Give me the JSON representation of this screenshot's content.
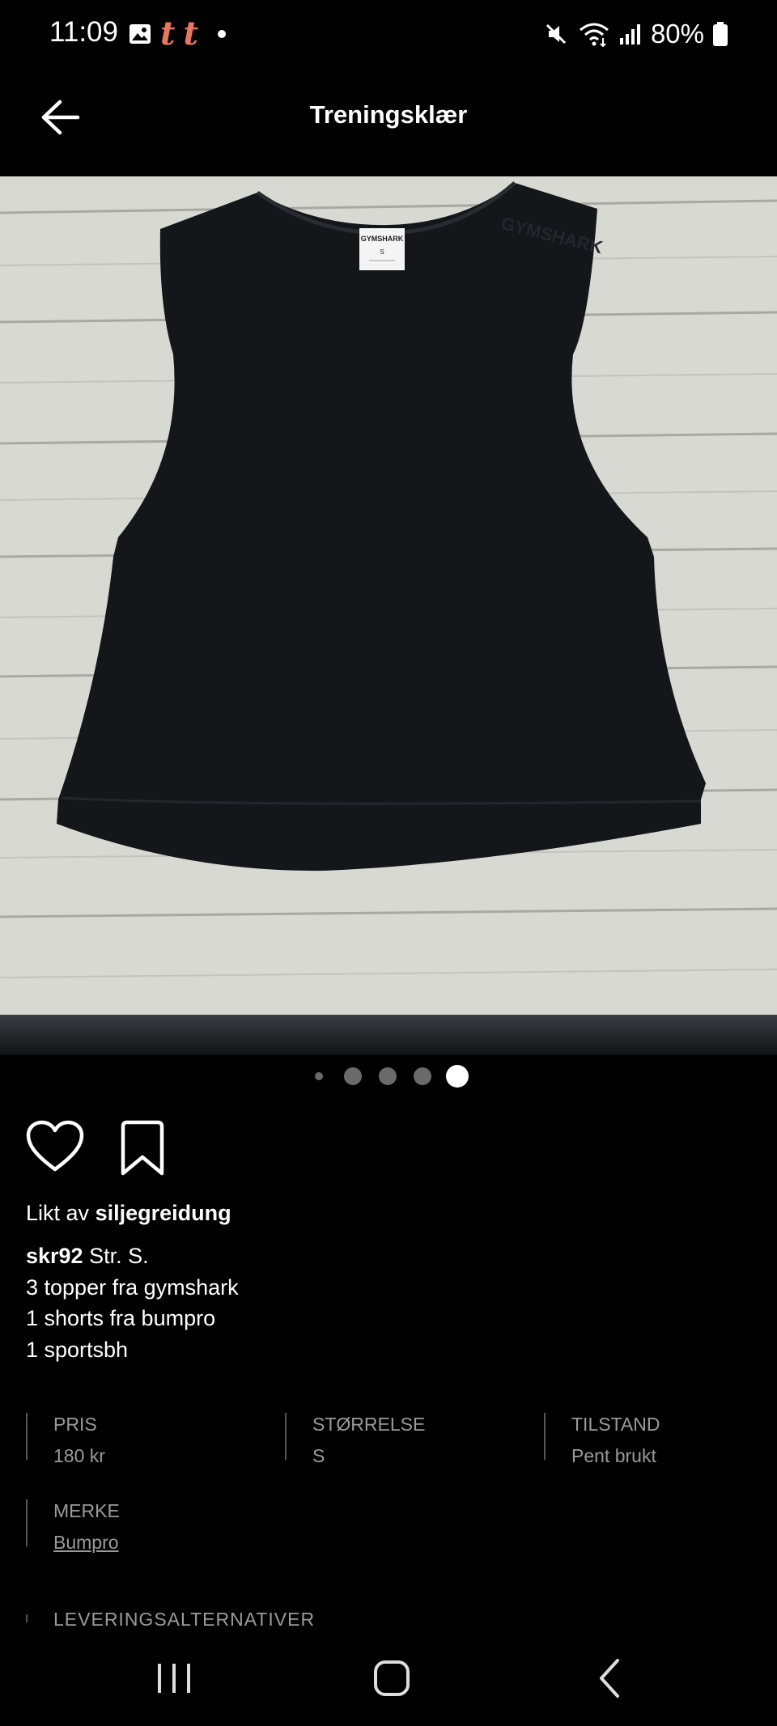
{
  "status_bar": {
    "time": "11:09",
    "battery": "80%",
    "icons": [
      "gallery-icon",
      "tumblr-icon",
      "tumblr-icon",
      "dot-icon",
      "mute-icon",
      "wifi-icon",
      "signal-icon",
      "battery-icon"
    ]
  },
  "header": {
    "title": "Treningsklær"
  },
  "photo": {
    "label_brand": "GYMSHARK",
    "label_size": "S",
    "shoulder_print": "GYMSHARK"
  },
  "carousel": {
    "count": 5,
    "active_index": 4
  },
  "social": {
    "liked_prefix": "Likt av",
    "liked_user": "siljegreidung"
  },
  "description": {
    "user": "skr92",
    "first_line": " Str. S.",
    "lines": [
      "3 topper fra gymshark",
      "1 shorts fra bumpro",
      "1 sportsbh"
    ]
  },
  "details": {
    "price_label": "PRIS",
    "price_value": "180 kr",
    "size_label": "STØRRELSE",
    "size_value": "S",
    "condition_label": "TILSTAND",
    "condition_value": "Pent brukt",
    "brand_label": "MERKE",
    "brand_value": "Bumpro",
    "delivery_label": "LEVERINGSALTERNATIVER"
  },
  "nav": {
    "icons": [
      "recents-icon",
      "home-icon",
      "back-icon"
    ]
  },
  "colors": {
    "background": "#000000",
    "text": "#ffffff",
    "muted": "#9a9a9a",
    "tumblr_accent": "#e8775e"
  }
}
